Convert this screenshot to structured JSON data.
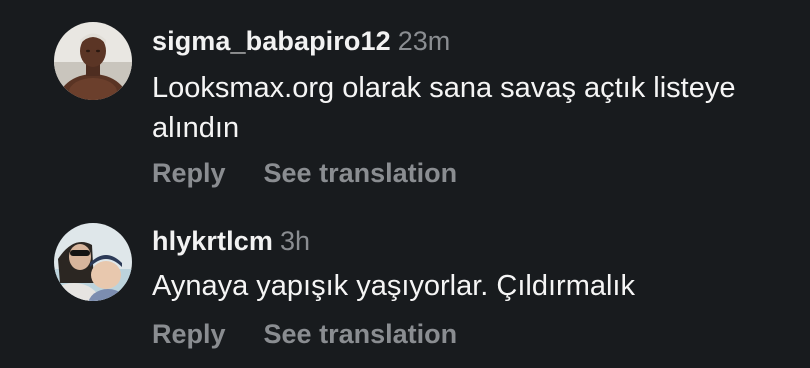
{
  "comments": [
    {
      "username": "sigma_babapiro12",
      "timestamp": "23m",
      "text": "Looksmax.org olarak sana savaş açtık listeye alındın",
      "reply_label": "Reply",
      "translate_label": "See translation"
    },
    {
      "username": "hlykrtlcm",
      "timestamp": "3h",
      "text": "Aynaya yapışık yaşıyorlar. Çıldırmalık",
      "reply_label": "Reply",
      "translate_label": "See translation"
    }
  ],
  "colors": {
    "background": "#181b1e",
    "primary_text": "#f5f5f5",
    "secondary_text": "#8a8d91"
  }
}
